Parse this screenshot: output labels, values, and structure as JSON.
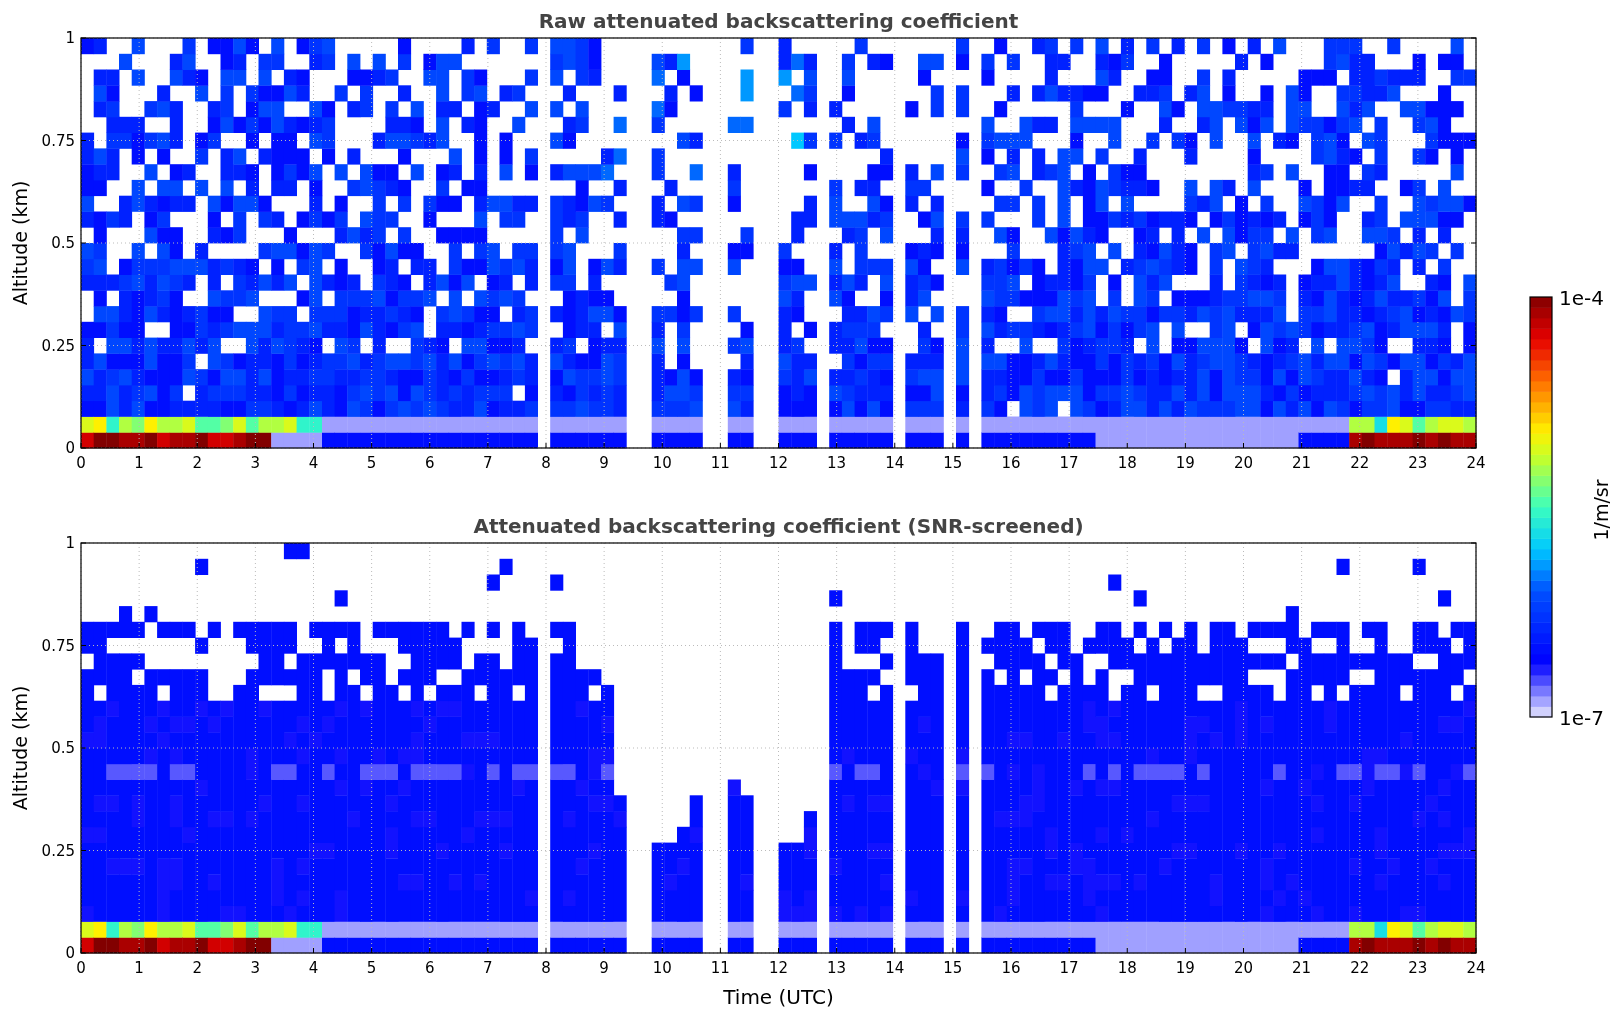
{
  "panels": [
    {
      "kind": "raw",
      "title": "Raw attenuated backscattering coefficient",
      "ylabel": "Altitude (km)",
      "yticks": [
        "1",
        "0.75",
        "0.5",
        "0.25",
        "0"
      ],
      "xticks": [
        "0",
        "1",
        "2",
        "3",
        "4",
        "5",
        "6",
        "7",
        "8",
        "9",
        "10",
        "11",
        "12",
        "13",
        "14",
        "15",
        "16",
        "17",
        "18",
        "19",
        "20",
        "21",
        "22",
        "23",
        "24"
      ]
    },
    {
      "kind": "screened",
      "title": "Attenuated backscattering coefficient (SNR-screened)",
      "ylabel": "Altitude (km)",
      "yticks": [
        "1",
        "0.75",
        "0.5",
        "0.25",
        "0"
      ],
      "xticks": [
        "0",
        "1",
        "2",
        "3",
        "4",
        "5",
        "6",
        "7",
        "8",
        "9",
        "10",
        "11",
        "12",
        "13",
        "14",
        "15",
        "16",
        "17",
        "18",
        "19",
        "20",
        "21",
        "22",
        "23",
        "24"
      ]
    }
  ],
  "xlabel": "Time (UTC)",
  "colorbar": {
    "max_label": "1e-4",
    "min_label": "1e-7",
    "label": "1/m/sr"
  }
}
